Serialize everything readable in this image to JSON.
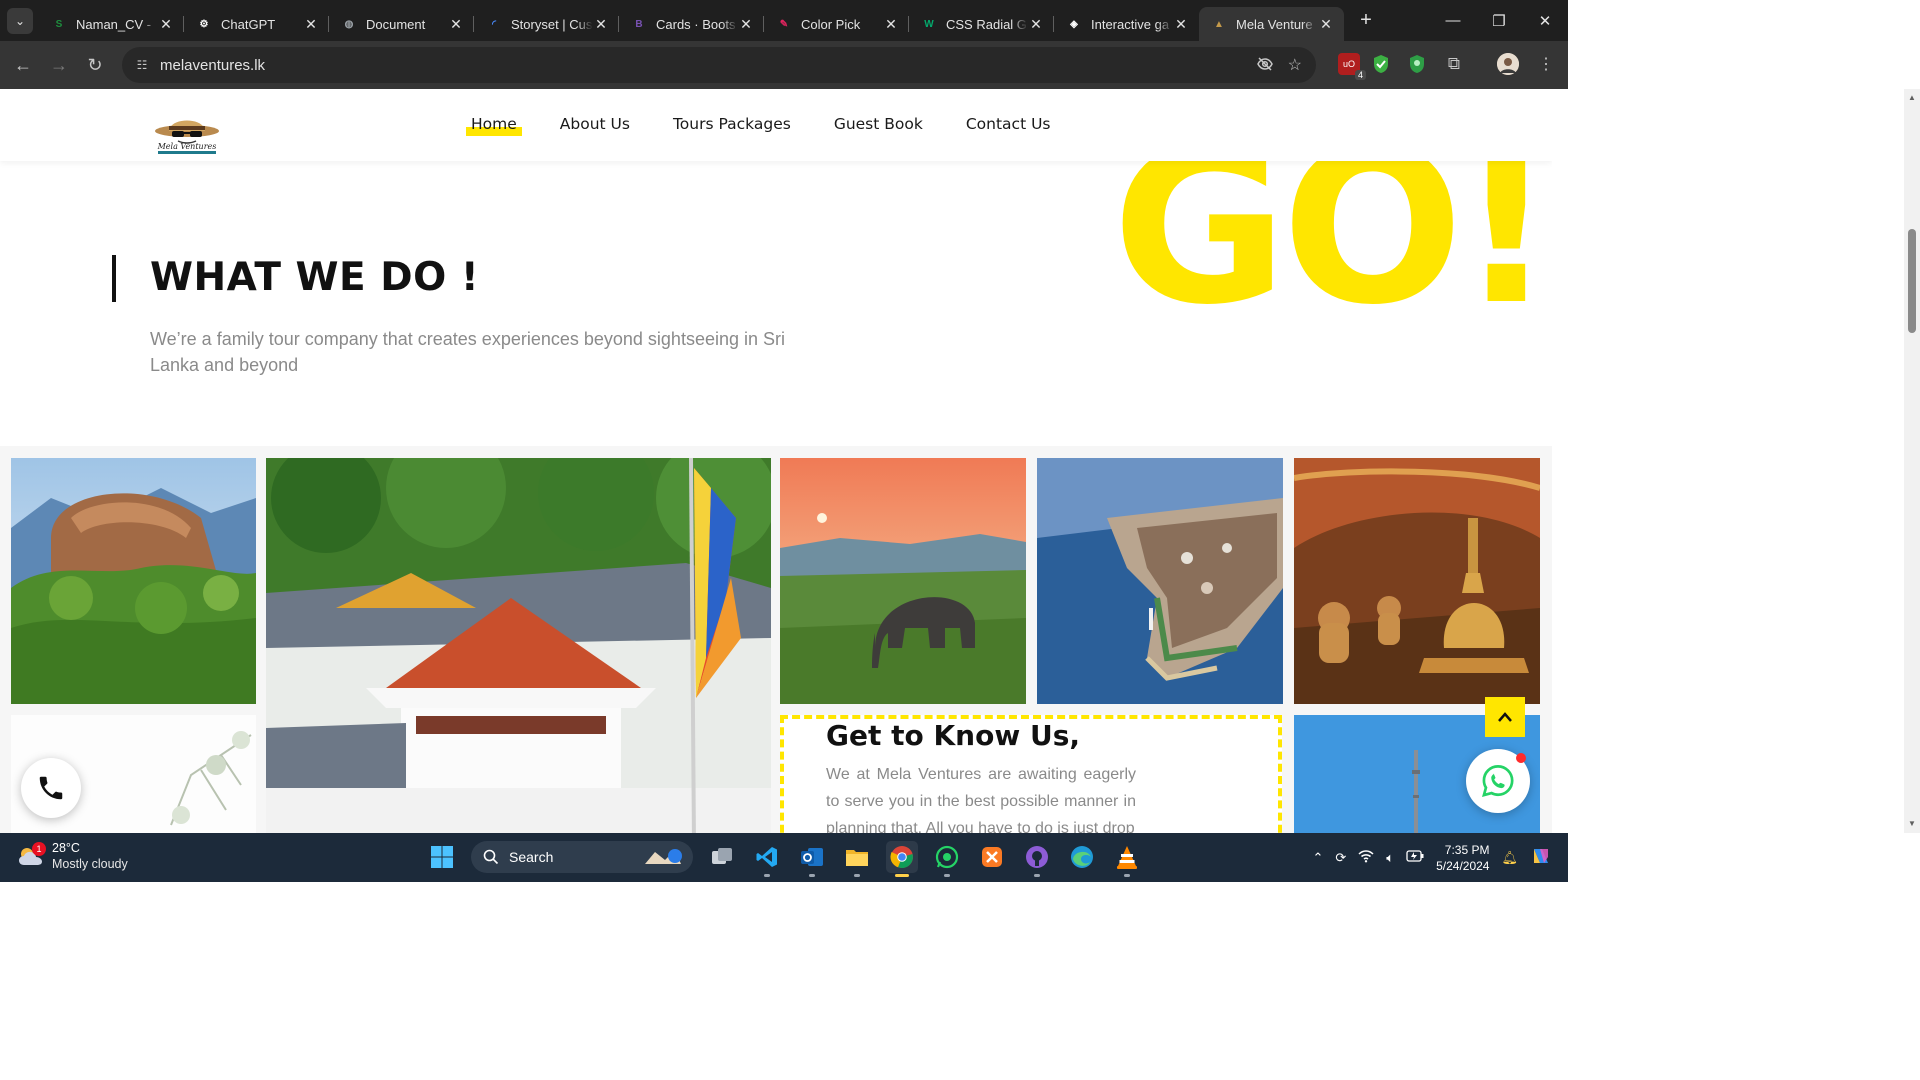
{
  "browser": {
    "tabs": [
      {
        "title": "Naman_CV - ",
        "favicon": "green-s-icon",
        "color": "#1e8e3e",
        "glyph": "S"
      },
      {
        "title": "ChatGPT",
        "favicon": "chatgpt-icon",
        "color": "#ffffff",
        "glyph": "⚙"
      },
      {
        "title": "Document",
        "favicon": "globe-icon",
        "color": "#9aa0a6",
        "glyph": "◍"
      },
      {
        "title": "Storyset | Cus",
        "favicon": "loading-spinner-icon",
        "color": "#4a8cff",
        "glyph": "◜"
      },
      {
        "title": "Cards · Boots",
        "favicon": "bootstrap-icon",
        "color": "#7952b3",
        "glyph": "B"
      },
      {
        "title": "Color Pick",
        "favicon": "color-picker-icon",
        "color": "#e0245e",
        "glyph": "✎"
      },
      {
        "title": "CSS Radial Gr",
        "favicon": "w3-icon",
        "color": "#04aa6d",
        "glyph": "W"
      },
      {
        "title": "Interactive ga",
        "favicon": "codepen-icon",
        "color": "#ffffff",
        "glyph": "◈"
      },
      {
        "title": "Mela Venture",
        "favicon": "mela-ventures-icon",
        "color": "#c49a4a",
        "glyph": "▲"
      }
    ],
    "active_tab_index": 8,
    "url": "melaventures.lk",
    "extension_badge": "4"
  },
  "site": {
    "nav": [
      {
        "label": "Home",
        "active": true
      },
      {
        "label": "About Us",
        "active": false
      },
      {
        "label": "Tours Packages",
        "active": false
      },
      {
        "label": "Guest Book",
        "active": false
      },
      {
        "label": "Contact Us",
        "active": false
      }
    ],
    "hero_word": "GO!",
    "section_title": "WHAT WE DO !",
    "section_text": "We’re a family tour company that creates experiences beyond sightseeing in Sri Lanka and beyond",
    "know_title": "Get to Know Us,",
    "know_text": "We at Mela Ventures are awaiting eagerly to serve you in the best possible manner in planning that. All you have to do is just drop",
    "accent_color": "#ffe600",
    "gallery": [
      {
        "name": "sigiriya-rock-image",
        "subject": "Sigiriya rock fortress"
      },
      {
        "name": "temple-of-tooth-image",
        "subject": "Temple of the Tooth, Kandy"
      },
      {
        "name": "elephant-sunset-image",
        "subject": "Wild elephant at sunset"
      },
      {
        "name": "galle-fort-aerial-image",
        "subject": "Galle fort aerial view"
      },
      {
        "name": "dambulla-cave-temple-image",
        "subject": "Dambulla cave temple stupa"
      },
      {
        "name": "tree-branches-image",
        "subject": "Tree branches"
      },
      {
        "name": "lotus-tower-image",
        "subject": "Tower against blue sky"
      }
    ]
  },
  "taskbar": {
    "weather_temp": "28°C",
    "weather_cond": "Mostly cloudy",
    "weather_badge": "1",
    "search_label": "Search",
    "time": "7:35 PM",
    "date": "5/24/2024"
  }
}
